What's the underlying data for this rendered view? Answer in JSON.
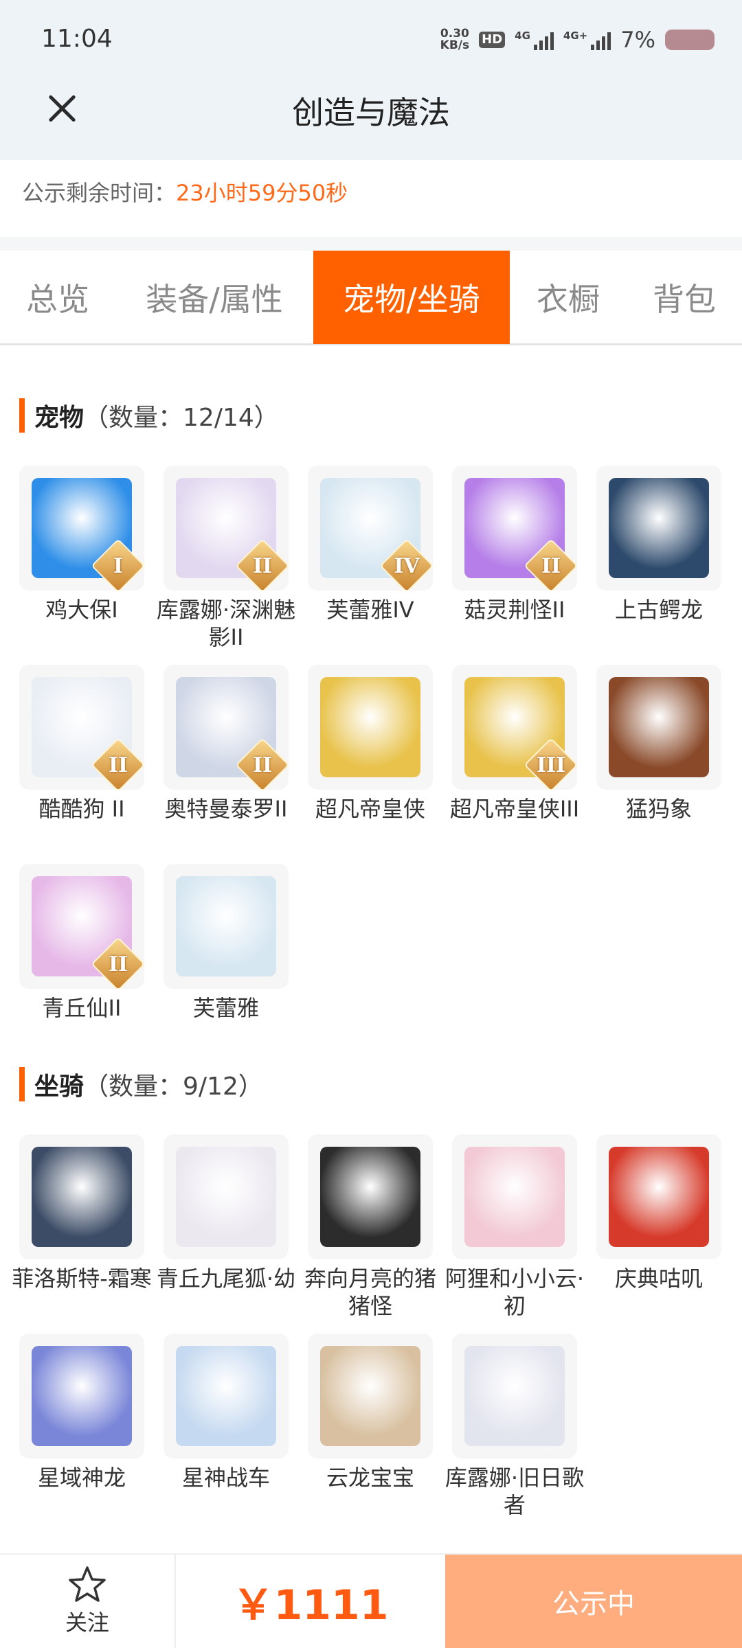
{
  "status_bar": {
    "time": "11:04",
    "net_speed_value": "0.30",
    "net_speed_unit": "KB/s",
    "hd_badge": "HD",
    "signal1_label": "4G",
    "signal2_label": "4G+",
    "battery_percent": "7%"
  },
  "header": {
    "title": "创造与魔法"
  },
  "countdown": {
    "label": "公示剩余时间：",
    "value": "23小时59分50秒"
  },
  "tabs": [
    {
      "label": "总览"
    },
    {
      "label": "装备/属性"
    },
    {
      "label": "宠物/坐骑",
      "active": true
    },
    {
      "label": "衣橱"
    },
    {
      "label": "背包"
    }
  ],
  "pets": {
    "title": "宠物",
    "count": "（数量：12/14）",
    "items": [
      {
        "name": "鸡大保I",
        "rank": "I",
        "color": "#2f8fe8"
      },
      {
        "name": "库露娜·深渊魅影II",
        "rank": "II",
        "color": "#e2d8f0"
      },
      {
        "name": "芙蕾雅IV",
        "rank": "IV",
        "color": "#d7e7f2"
      },
      {
        "name": "菇灵荆怪II",
        "rank": "II",
        "color": "#b57ee8"
      },
      {
        "name": "上古鳄龙",
        "rank": "",
        "color": "#2d4a6c"
      },
      {
        "name": "酷酷狗 II",
        "rank": "II",
        "color": "#e9eef5"
      },
      {
        "name": "奥特曼泰罗II",
        "rank": "II",
        "color": "#cfd6e6"
      },
      {
        "name": "超凡帝皇侠",
        "rank": "",
        "color": "#e8c24a"
      },
      {
        "name": "超凡帝皇侠III",
        "rank": "III",
        "color": "#e8c24a"
      },
      {
        "name": "猛犸象",
        "rank": "",
        "color": "#8a4a2a"
      },
      {
        "name": "青丘仙II",
        "rank": "II",
        "color": "#e6b8e8"
      },
      {
        "name": "芙蕾雅",
        "rank": "",
        "color": "#d7e7f2"
      }
    ]
  },
  "mounts": {
    "title": "坐骑",
    "count": "（数量：9/12）",
    "items": [
      {
        "name": "菲洛斯特-霜寒",
        "color": "#3c4c66"
      },
      {
        "name": "青丘九尾狐·幼",
        "color": "#ebe8f0"
      },
      {
        "name": "奔向月亮的猪猪怪",
        "color": "#2c2c2c"
      },
      {
        "name": "阿狸和小小云·初",
        "color": "#f2c9d4"
      },
      {
        "name": "庆典咕叽",
        "color": "#d63a2a"
      },
      {
        "name": "星域神龙",
        "color": "#7a86d8"
      },
      {
        "name": "星神战车",
        "color": "#c5d9f0"
      },
      {
        "name": "云龙宝宝",
        "color": "#d8c0a0"
      },
      {
        "name": "库露娜·旧日歌者",
        "color": "#e2e4ee"
      }
    ]
  },
  "bottom_bar": {
    "follow_label": "关注",
    "price": "￥1111",
    "status_label": "公示中"
  }
}
